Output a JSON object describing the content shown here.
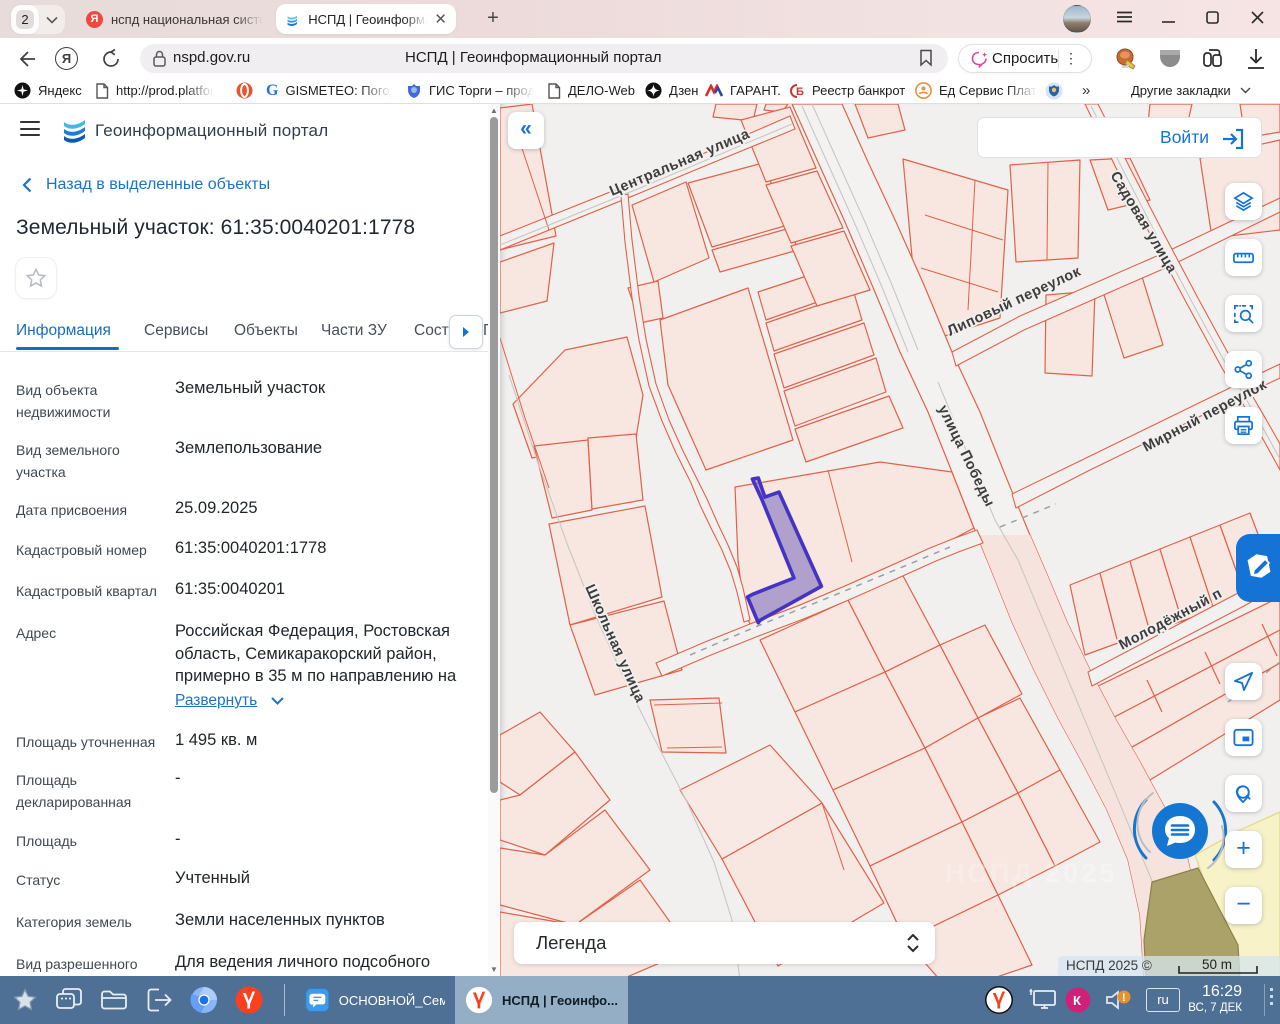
{
  "browser": {
    "tab_counter": "2",
    "tabs": [
      {
        "title": "нспд национальная систе",
        "favicon": "yandex-icon"
      },
      {
        "title": "НСПД | Геоинформаци",
        "favicon": "nspd-icon"
      }
    ],
    "new_tab": "+",
    "address": {
      "domain": "nspd.gov.ru",
      "page_title": "НСПД | Геоинформационный портал"
    },
    "ask_button": "Спросить",
    "bookmarks": [
      {
        "label": "Яндекс"
      },
      {
        "label": "http://prod.platfor"
      },
      {
        "label": ""
      },
      {
        "label": "GISMETEO: Погод"
      },
      {
        "label": "ГИС Торги – прод"
      },
      {
        "label": "ДЕЛО-Web"
      },
      {
        "label": "Дзен"
      },
      {
        "label": "ГАРАНТ."
      },
      {
        "label": "Реестр банкрот"
      },
      {
        "label": "Ед Сервис Плат"
      }
    ],
    "overflow_chevron": "»",
    "other_bookmarks": "Другие закладки"
  },
  "panel": {
    "app_title": "Геоинформационный портал",
    "back_link": "Назад в выделенные объекты",
    "title": "Земельный участок: 61:35:0040201:1778",
    "tabs": [
      "Информация",
      "Сервисы",
      "Объекты",
      "Части ЗУ",
      "Соста"
    ],
    "tab_overflow": "Г",
    "fields": [
      {
        "label": "Вид объекта недвижимости",
        "value": "Земельный участок"
      },
      {
        "label": "Вид земельного участка",
        "value": "Землепользование"
      },
      {
        "label": "Дата присвоения",
        "value": "25.09.2025"
      },
      {
        "label": "Кадастровый номер",
        "value": "61:35:0040201:1778"
      },
      {
        "label": "Кадастровый квартал",
        "value": "61:35:0040201"
      },
      {
        "label": "Адрес",
        "value": "Российская Федерация, Ростовская область, Семикаракорский район, примерно в 35 м по направлению на"
      },
      {
        "label": "Площадь уточненная",
        "value": "1 495 кв. м"
      },
      {
        "label": "Площадь декларированная",
        "value": "-"
      },
      {
        "label": "Площадь",
        "value": "-"
      },
      {
        "label": "Статус",
        "value": "Учтенный"
      },
      {
        "label": "Категория земель",
        "value": "Земли населенных пунктов"
      },
      {
        "label": "Вид разрешенного",
        "value": "Для ведения личного подсобного"
      }
    ],
    "expand_link": "Развернуть"
  },
  "map": {
    "login_button": "Войти",
    "legend_label": "Легенда",
    "attribution": "НСПД 2025 ©",
    "scale_label": "50 m",
    "selected_parcel": "61:35:0040201:1778",
    "streets": [
      {
        "name": "Центральная  улица"
      },
      {
        "name": "улица Победы"
      },
      {
        "name": "Школьная улица"
      },
      {
        "name": "Липовый  переулок"
      },
      {
        "name": "Садовая  улица"
      },
      {
        "name": "Мирный  переулок"
      },
      {
        "name": "Молодёжный  п"
      }
    ],
    "watermark": "НСПД 2025"
  },
  "taskbar": {
    "window1": "ОСНОВНОЙ_Сем...",
    "window2": "НСПД | Геоинфо...",
    "lang": "ru",
    "time": "16:29",
    "date": "ВС, 7 ДЕК"
  }
}
